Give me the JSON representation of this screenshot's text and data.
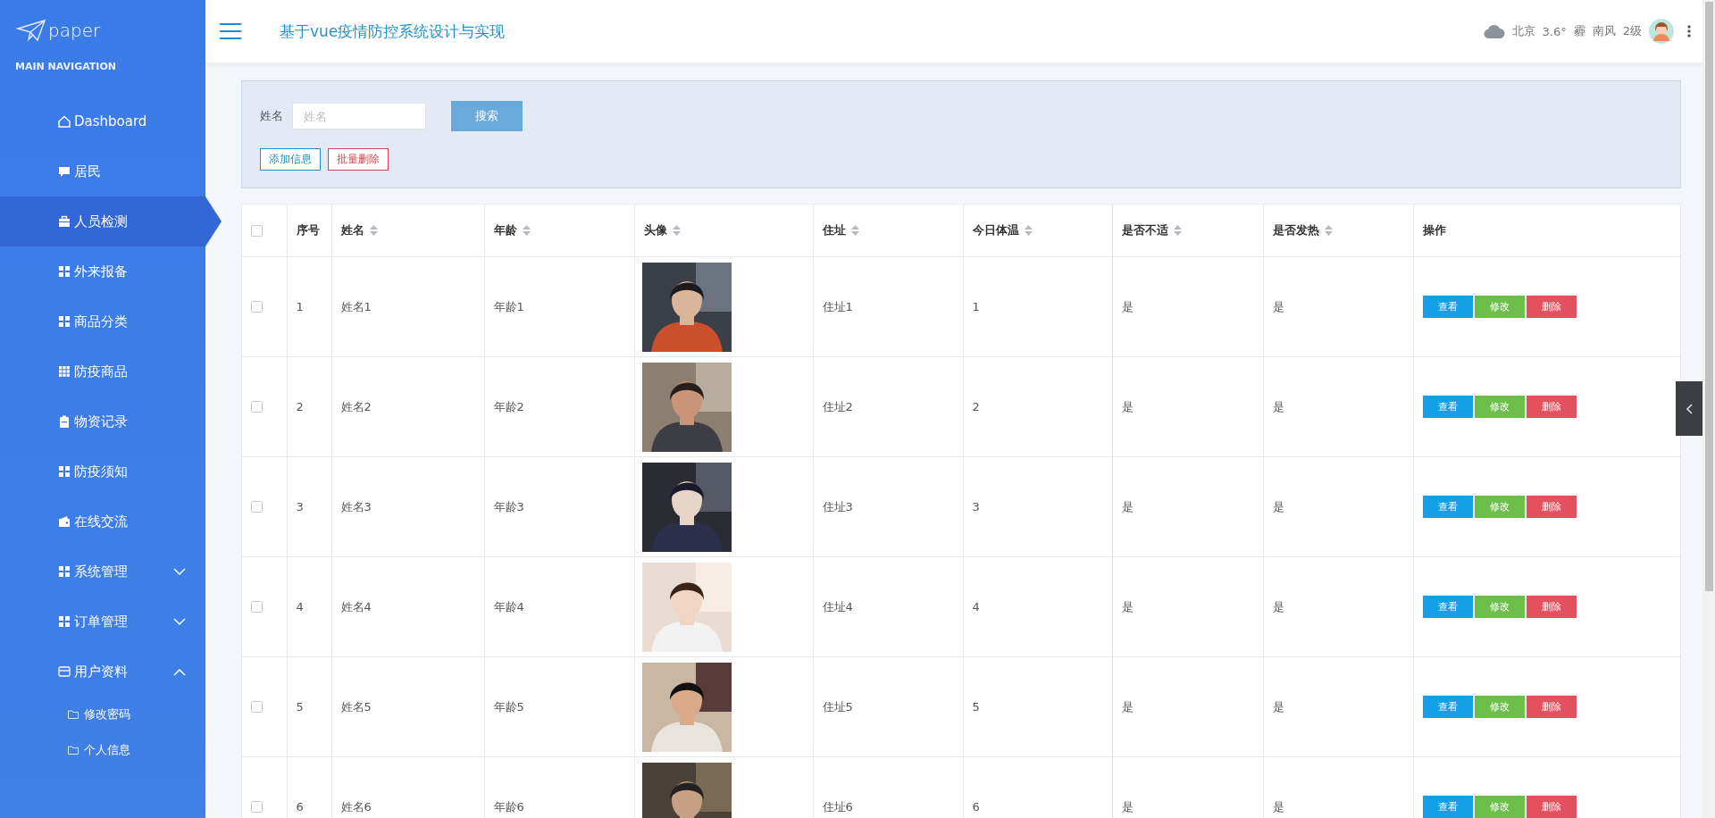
{
  "brand": "paper",
  "nav_heading": "MAIN NAVIGATION",
  "sidebar": {
    "items": [
      {
        "label": "Dashboard",
        "selected": false
      },
      {
        "label": "居民",
        "selected": false
      },
      {
        "label": "人员检测",
        "selected": true
      },
      {
        "label": "外来报备",
        "selected": false
      },
      {
        "label": "商品分类",
        "selected": false
      },
      {
        "label": "防疫商品",
        "selected": false
      },
      {
        "label": "物资记录",
        "selected": false
      },
      {
        "label": "防疫须知",
        "selected": false
      },
      {
        "label": "在线交流",
        "selected": false
      },
      {
        "label": "系统管理",
        "selected": false,
        "expanded": false
      },
      {
        "label": "订单管理",
        "selected": false,
        "expanded": false
      },
      {
        "label": "用户资料",
        "selected": false,
        "expanded": true,
        "children": [
          {
            "label": "修改密码",
            "selected": false
          },
          {
            "label": "个人信息",
            "selected": false
          }
        ]
      }
    ]
  },
  "header": {
    "title": "基于vue疫情防控系统设计与实现",
    "weather": {
      "city": "北京",
      "temperature": "3.6°",
      "condition": "霾",
      "wind": "南风",
      "wind_level": "2级"
    }
  },
  "search": {
    "label": "姓名",
    "placeholder": "姓名",
    "button": "搜索",
    "actions": [
      {
        "label": "添加信息",
        "kind": "add"
      },
      {
        "label": "批量删除",
        "kind": "delete"
      }
    ]
  },
  "table": {
    "select_all": {
      "checked": false
    },
    "columns": [
      {
        "label": "序号",
        "sortable": false
      },
      {
        "label": "姓名",
        "sortable": true
      },
      {
        "label": "年龄",
        "sortable": true
      },
      {
        "label": "头像",
        "sortable": true
      },
      {
        "label": "住址",
        "sortable": true
      },
      {
        "label": "今日体温",
        "sortable": true
      },
      {
        "label": "是否不适",
        "sortable": true
      },
      {
        "label": "是否发热",
        "sortable": true
      },
      {
        "label": "操作",
        "sortable": false
      }
    ],
    "rows": [
      {
        "checked": false,
        "cells": [
          "1",
          "姓名1",
          "年龄1",
          null,
          "住址1",
          "1",
          "是",
          "是"
        ],
        "actions": [
          {
            "label": "查看",
            "kind": "view"
          },
          {
            "label": "修改",
            "kind": "edit"
          },
          {
            "label": "删除",
            "kind": "delete"
          }
        ]
      },
      {
        "checked": false,
        "cells": [
          "2",
          "姓名2",
          "年龄2",
          null,
          "住址2",
          "2",
          "是",
          "是"
        ],
        "actions": [
          {
            "label": "查看",
            "kind": "view"
          },
          {
            "label": "修改",
            "kind": "edit"
          },
          {
            "label": "删除",
            "kind": "delete"
          }
        ]
      },
      {
        "checked": false,
        "cells": [
          "3",
          "姓名3",
          "年龄3",
          null,
          "住址3",
          "3",
          "是",
          "是"
        ],
        "actions": [
          {
            "label": "查看",
            "kind": "view"
          },
          {
            "label": "修改",
            "kind": "edit"
          },
          {
            "label": "删除",
            "kind": "delete"
          }
        ]
      },
      {
        "checked": false,
        "cells": [
          "4",
          "姓名4",
          "年龄4",
          null,
          "住址4",
          "4",
          "是",
          "是"
        ],
        "actions": [
          {
            "label": "查看",
            "kind": "view"
          },
          {
            "label": "修改",
            "kind": "edit"
          },
          {
            "label": "删除",
            "kind": "delete"
          }
        ]
      },
      {
        "checked": false,
        "cells": [
          "5",
          "姓名5",
          "年龄5",
          null,
          "住址5",
          "5",
          "是",
          "是"
        ],
        "actions": [
          {
            "label": "查看",
            "kind": "view"
          },
          {
            "label": "修改",
            "kind": "edit"
          },
          {
            "label": "删除",
            "kind": "delete"
          }
        ]
      },
      {
        "checked": false,
        "cells": [
          "6",
          "姓名6",
          "年龄6",
          null,
          "住址6",
          "6",
          "是",
          "是"
        ],
        "actions": [
          {
            "label": "查看",
            "kind": "view"
          },
          {
            "label": "修改",
            "kind": "edit"
          },
          {
            "label": "删除",
            "kind": "delete"
          }
        ]
      }
    ]
  }
}
